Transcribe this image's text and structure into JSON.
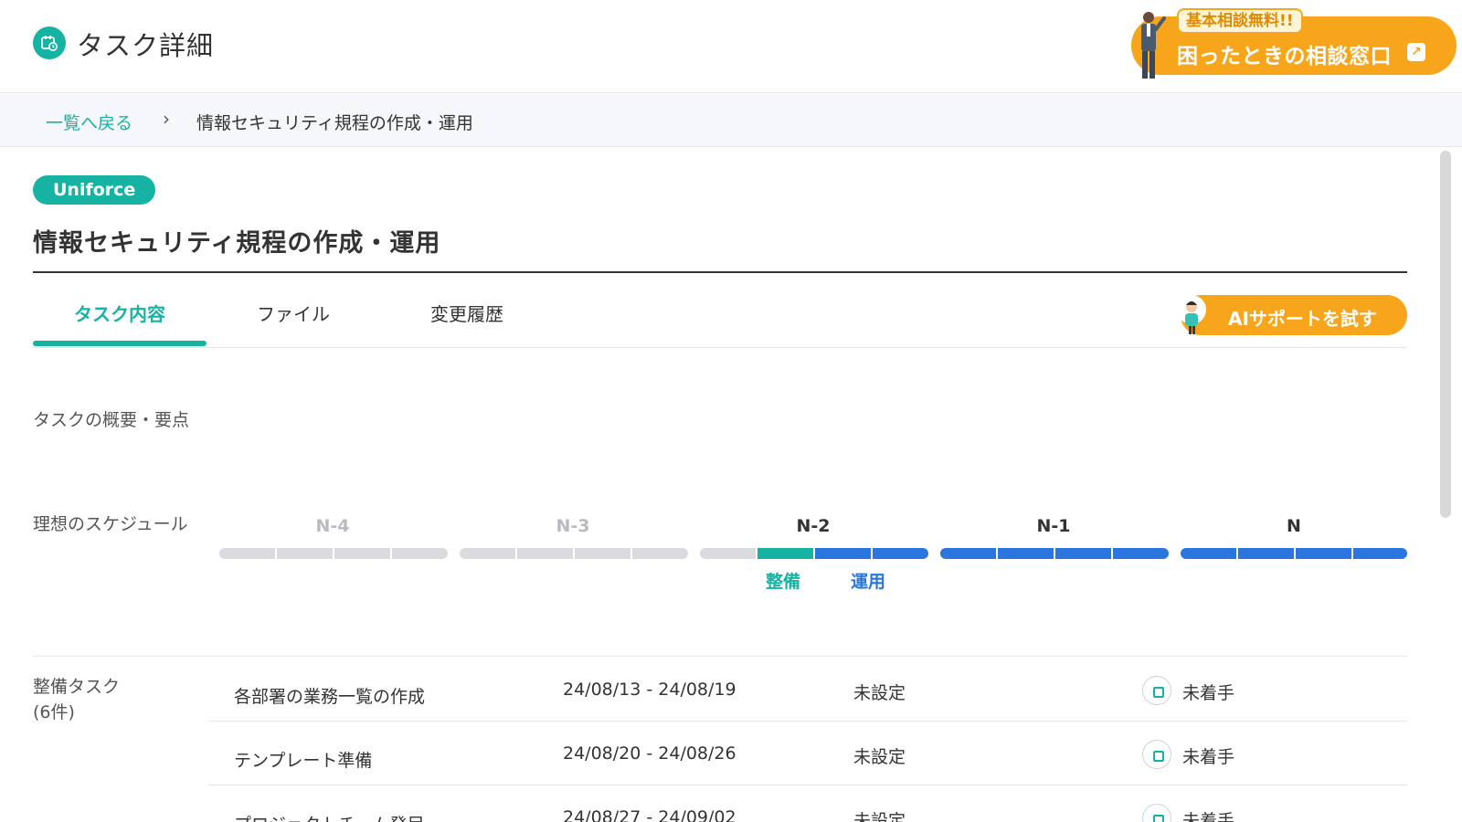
{
  "header": {
    "title": "タスク詳細",
    "consult_badge": "基本相談無料!!",
    "consult_label": "困ったときの相談窓口"
  },
  "breadcrumb": {
    "back": "一覧へ戻る",
    "separator": "›",
    "current": "情報セキュリティ規程の作成・運用"
  },
  "task": {
    "tag": "Uniforce",
    "title": "情報セキュリティ規程の作成・運用"
  },
  "tabs": [
    {
      "label": "タスク内容",
      "active": true
    },
    {
      "label": "ファイル",
      "active": false
    },
    {
      "label": "変更履歴",
      "active": false
    }
  ],
  "ai_button": "AIサポートを試す",
  "sections": {
    "overview": "タスクの概要・要点",
    "schedule": "理想のスケジュール",
    "tasks": "整備タスク",
    "tasks_count": "(6件)"
  },
  "schedule": {
    "phases": [
      "N-4",
      "N-3",
      "N-2",
      "N-1",
      "N"
    ],
    "prep_label": "整備",
    "ops_label": "運用"
  },
  "task_list": [
    {
      "name": "各部署の業務一覧の作成",
      "dates": "24/08/13 - 24/08/19",
      "assignee": "未設定",
      "status": "未着手"
    },
    {
      "name": "テンプレート準備",
      "dates": "24/08/20 - 24/08/26",
      "assignee": "未設定",
      "status": "未着手"
    },
    {
      "name": "プロジェクトチーム発足",
      "dates": "24/08/27 - 24/09/02",
      "assignee": "未設定",
      "status": "未着手"
    }
  ],
  "colors": {
    "accent": "#16b3a3",
    "orange": "#f7a61b",
    "blue": "#2a76de",
    "gray": "#d9dbdf"
  }
}
